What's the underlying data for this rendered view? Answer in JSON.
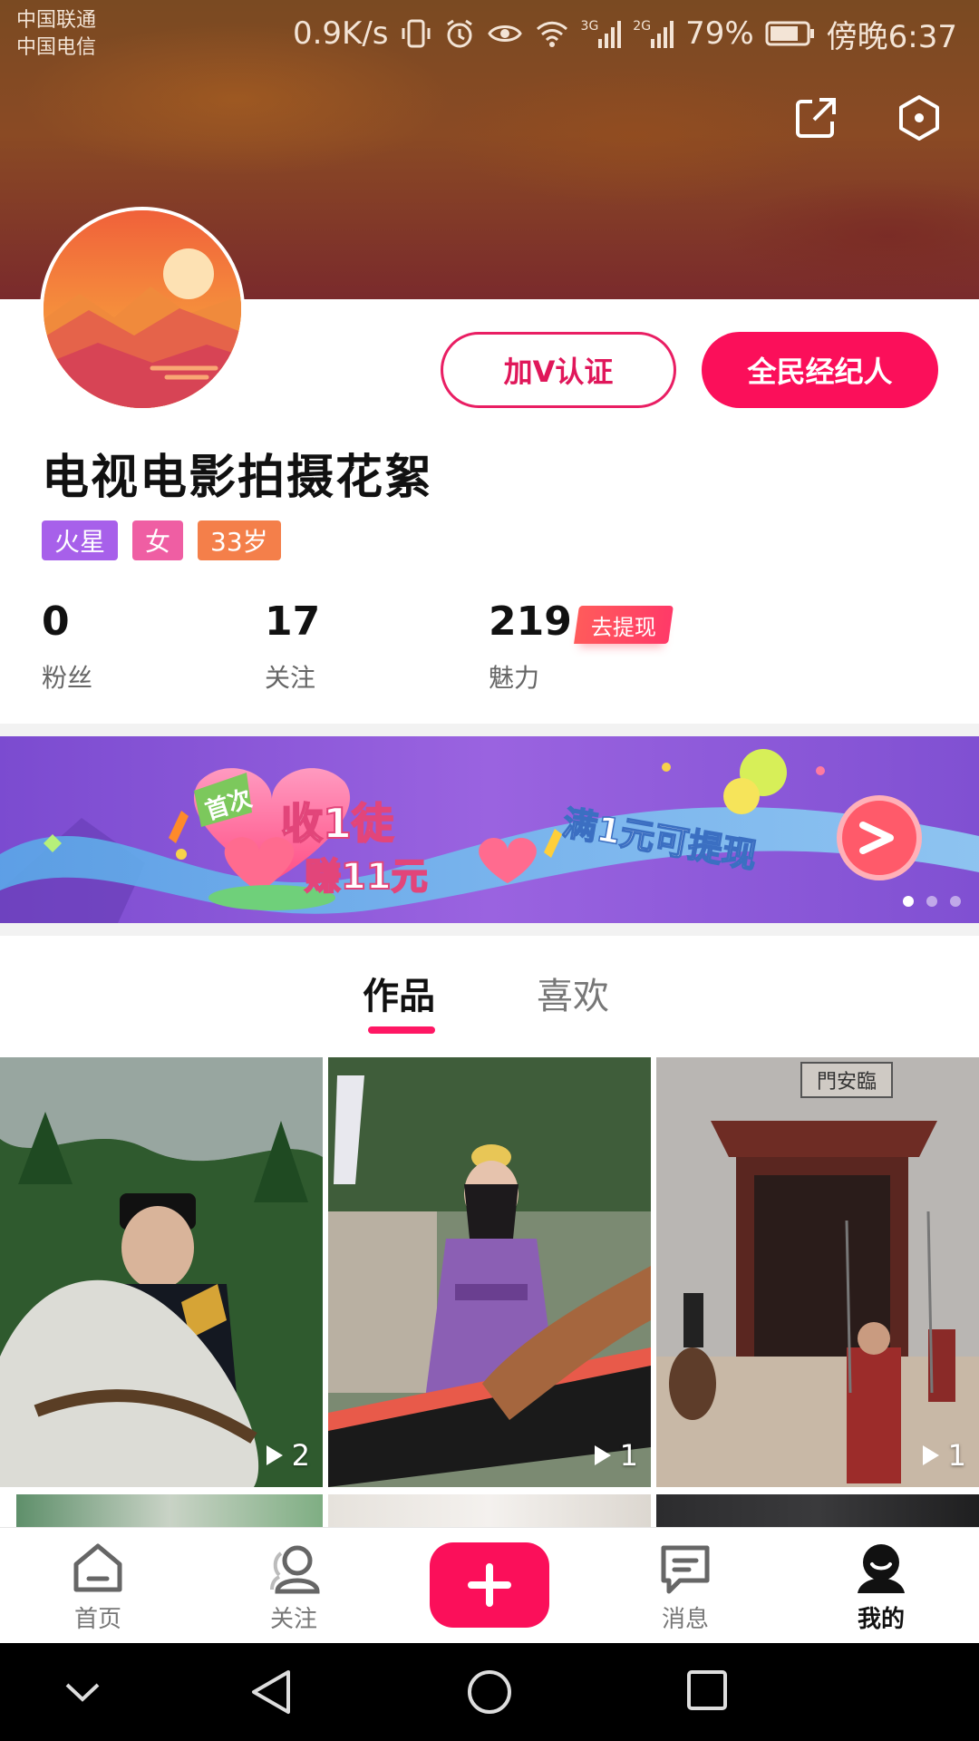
{
  "status_bar": {
    "carrier_1": "中国联通",
    "carrier_2": "中国电信",
    "net_speed": "0.9K/s",
    "signal_1_label": "3G",
    "signal_2_label": "2G",
    "battery": "79%",
    "time": "傍晚6:37"
  },
  "header": {
    "icons": [
      "share-icon",
      "settings-icon"
    ]
  },
  "profile": {
    "verify_button": "加V认证",
    "agent_button": "全民经纪人",
    "username": "电视电影拍摄花絮",
    "tags": [
      "火星",
      "女",
      "33岁"
    ],
    "stats": [
      {
        "value": "0",
        "label": "粉丝"
      },
      {
        "value": "17",
        "label": "关注"
      },
      {
        "value": "219",
        "label": "魅力"
      }
    ],
    "withdraw_badge": "去提现"
  },
  "banner": {
    "badge": "首次",
    "headline_1": "收1徒",
    "headline_2": "赚11元",
    "slogan": "满1元可提现",
    "active_dot": 0,
    "dot_count": 3
  },
  "tabs": [
    {
      "label": "作品",
      "active": true
    },
    {
      "label": "喜欢",
      "active": false
    }
  ],
  "videos": [
    {
      "plays": "2"
    },
    {
      "plays": "1"
    },
    {
      "plays": "1"
    }
  ],
  "scene_text": {
    "gate_sign": "門安臨"
  },
  "bottom_nav": [
    {
      "label": "首页",
      "icon": "home-icon",
      "active": false
    },
    {
      "label": "关注",
      "icon": "follow-icon",
      "active": false
    },
    {
      "label": "",
      "icon": "plus-icon",
      "active": false
    },
    {
      "label": "消息",
      "icon": "message-icon",
      "active": false
    },
    {
      "label": "我的",
      "icon": "profile-icon",
      "active": true
    }
  ],
  "colors": {
    "accent": "#fb0f5a",
    "tag_purple": "#a760ea",
    "tag_pink": "#ef5ea3",
    "tag_orange": "#f47f4a"
  }
}
